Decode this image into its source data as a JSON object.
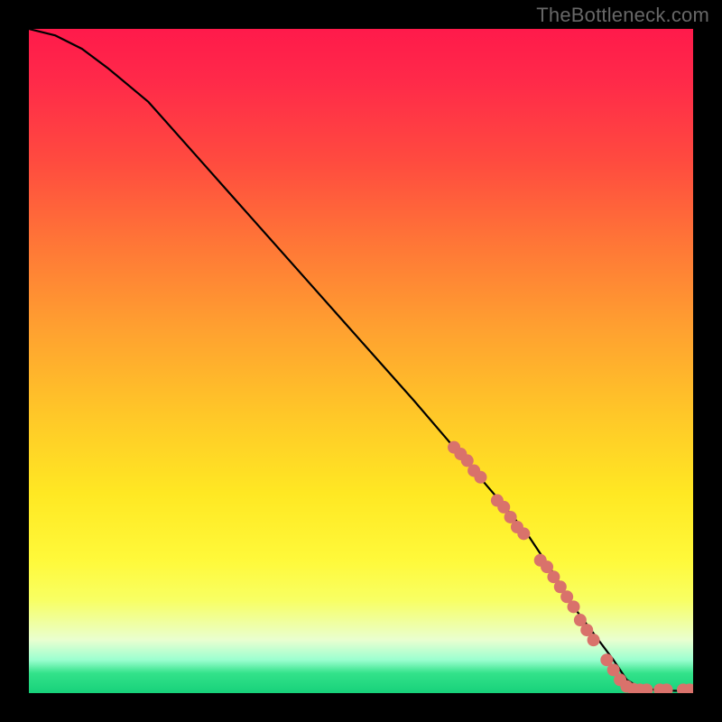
{
  "watermark": "TheBottleneck.com",
  "chart_data": {
    "type": "line",
    "title": "",
    "xlabel": "",
    "ylabel": "",
    "xlim": [
      0,
      100
    ],
    "ylim": [
      0,
      100
    ],
    "grid": false,
    "legend": false,
    "series": [
      {
        "name": "curve",
        "color": "#000000",
        "x": [
          0,
          4,
          8,
          12,
          18,
          26,
          34,
          42,
          50,
          58,
          64,
          70,
          75,
          79,
          82,
          85,
          88,
          90,
          92,
          95,
          100
        ],
        "y": [
          100,
          99,
          97,
          94,
          89,
          80,
          71,
          62,
          53,
          44,
          37,
          30,
          24,
          18,
          13,
          9,
          5,
          2,
          0.8,
          0.4,
          0.3
        ]
      }
    ],
    "markers": {
      "name": "highlighted-points",
      "color": "#d9726b",
      "radius_px": 7,
      "points": [
        {
          "x": 64,
          "y": 37
        },
        {
          "x": 65,
          "y": 36
        },
        {
          "x": 66,
          "y": 35
        },
        {
          "x": 67,
          "y": 33.5
        },
        {
          "x": 68,
          "y": 32.5
        },
        {
          "x": 70.5,
          "y": 29
        },
        {
          "x": 71.5,
          "y": 28
        },
        {
          "x": 72.5,
          "y": 26.5
        },
        {
          "x": 73.5,
          "y": 25
        },
        {
          "x": 74.5,
          "y": 24
        },
        {
          "x": 77,
          "y": 20
        },
        {
          "x": 78,
          "y": 19
        },
        {
          "x": 79,
          "y": 17.5
        },
        {
          "x": 80,
          "y": 16
        },
        {
          "x": 81,
          "y": 14.5
        },
        {
          "x": 82,
          "y": 13
        },
        {
          "x": 83,
          "y": 11
        },
        {
          "x": 84,
          "y": 9.5
        },
        {
          "x": 85,
          "y": 8
        },
        {
          "x": 87,
          "y": 5
        },
        {
          "x": 88,
          "y": 3.5
        },
        {
          "x": 89,
          "y": 2
        },
        {
          "x": 90,
          "y": 1
        },
        {
          "x": 91,
          "y": 0.6
        },
        {
          "x": 92,
          "y": 0.5
        },
        {
          "x": 93,
          "y": 0.5
        },
        {
          "x": 95,
          "y": 0.5
        },
        {
          "x": 96,
          "y": 0.5
        },
        {
          "x": 98.5,
          "y": 0.5
        },
        {
          "x": 99.5,
          "y": 0.5
        }
      ]
    },
    "background_gradient": {
      "top_color": "#ff1a4b",
      "bottom_color": "#17d17a"
    }
  }
}
